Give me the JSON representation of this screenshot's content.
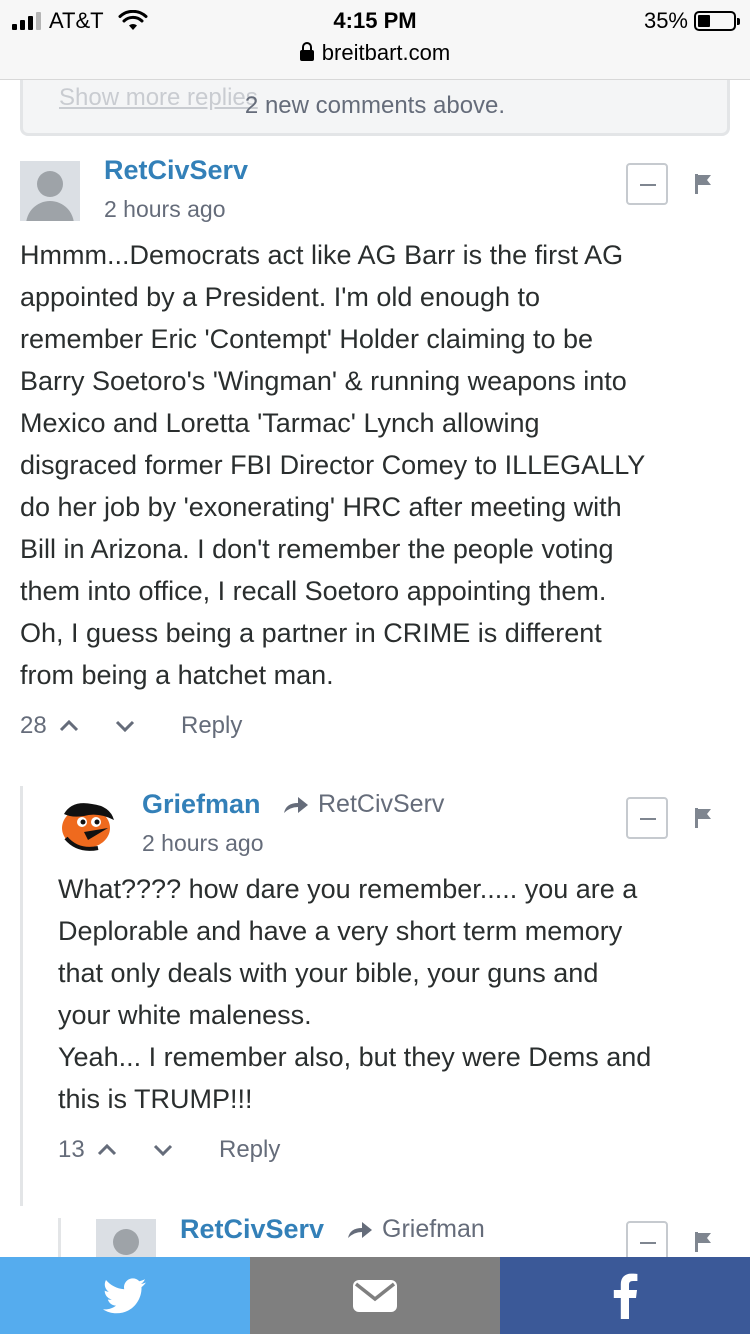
{
  "status_bar": {
    "carrier": "AT&T",
    "time": "4:15 PM",
    "url": "breitbart.com",
    "battery_percent_label": "35%",
    "battery_level": 0.35
  },
  "notice": {
    "ghost_text": "Show more replies",
    "new_comments": "2 new comments above."
  },
  "comments": [
    {
      "author": "RetCivServ",
      "time": "2 hours ago",
      "lines": [
        "Hmmm...Democrats act like AG Barr is the first AG",
        "appointed by a President. I'm old enough to",
        "remember Eric 'Contempt' Holder claiming to be",
        "Barry Soetoro's 'Wingman' & running weapons into",
        "Mexico and Loretta 'Tarmac' Lynch allowing",
        "disgraced former FBI Director Comey to ILLEGALLY",
        "do her job by 'exonerating' HRC after meeting with",
        "Bill in Arizona. I don't remember the people voting",
        "them into office, I recall Soetoro appointing them.",
        "Oh, I guess being a partner in CRIME is different",
        "from being a hatchet man."
      ],
      "votes": "28",
      "reply_label": "Reply"
    },
    {
      "author": "Griefman",
      "reply_to": "RetCivServ",
      "time": "2 hours ago",
      "lines": [
        "What???? how dare you remember..... you are a",
        "Deplorable and have a very short term memory",
        "that only deals with your bible, your guns and",
        "your white maleness.",
        "Yeah... I remember also, but they were Dems and",
        "this is TRUMP!!!"
      ],
      "votes": "13",
      "reply_label": "Reply"
    },
    {
      "author": "RetCivServ",
      "reply_to": "Griefman"
    }
  ],
  "share_bar": {
    "twitter_icon": "twitter-bird-icon",
    "email_icon": "envelope-icon",
    "facebook_icon": "facebook-f-icon",
    "colors": {
      "twitter": "#55acee",
      "email": "#7f7f7f",
      "facebook": "#3b5998"
    }
  }
}
